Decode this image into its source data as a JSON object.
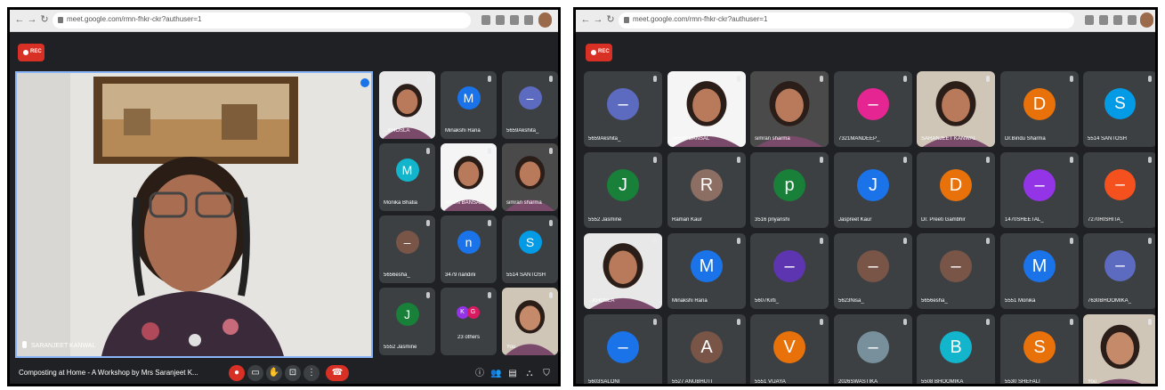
{
  "left": {
    "url": "meet.google.com/rmn-fhkr-ckr?authuser=1",
    "rec_label": "REC",
    "main_speaker": "SARANJEET KANWAL",
    "meeting_title": "Composting at Home - A Workshop by Mrs Saranjeet K...",
    "tiles": [
      {
        "name": "...KHOSLA",
        "type": "photo"
      },
      {
        "name": "Minakshi Rana",
        "type": "avatar",
        "letter": "M",
        "color": "#1a73e8"
      },
      {
        "name": "5659Akshita_",
        "type": "avatar",
        "letter": "–",
        "color": "#5c6bc0"
      },
      {
        "name": "Monika Bhatia",
        "type": "avatar",
        "letter": "M",
        "color": "#12b5cb"
      },
      {
        "name": "ARUN BANSAL",
        "type": "photo"
      },
      {
        "name": "simran sharma",
        "type": "photo"
      },
      {
        "name": "5656esha_",
        "type": "avatar",
        "letter": "–",
        "color": "#795548"
      },
      {
        "name": "3479 nandini",
        "type": "avatar",
        "letter": "n",
        "color": "#1a73e8"
      },
      {
        "name": "5514 SANTOSH",
        "type": "avatar",
        "letter": "S",
        "color": "#039be5"
      },
      {
        "name": "5552 Jasmine",
        "type": "avatar",
        "letter": "J",
        "color": "#188038"
      },
      {
        "name": "23 others",
        "type": "others"
      },
      {
        "name": "You",
        "type": "photo"
      }
    ],
    "others_badges": [
      "K",
      "G"
    ]
  },
  "right": {
    "url": "meet.google.com/rmn-fhkr-ckr?authuser=1",
    "rec_label": "REC",
    "tiles": [
      {
        "name": "5659Akshita_",
        "type": "avatar",
        "letter": "–",
        "color": "#5c6bc0"
      },
      {
        "name": "ARUN BANSAL",
        "type": "photo"
      },
      {
        "name": "simran sharma",
        "type": "photo"
      },
      {
        "name": "7321MANDEEP_",
        "type": "avatar",
        "letter": "–",
        "color": "#e52592"
      },
      {
        "name": "SARANJEET KANWAL",
        "type": "photo"
      },
      {
        "name": "Dr.Bindu Sharma",
        "type": "avatar",
        "letter": "D",
        "color": "#e8710a"
      },
      {
        "name": "5514 SANTOSH",
        "type": "avatar",
        "letter": "S",
        "color": "#039be5"
      },
      {
        "name": "5552 Jasmine",
        "type": "avatar",
        "letter": "J",
        "color": "#188038"
      },
      {
        "name": "Raman Kaur",
        "type": "avatar",
        "letter": "R",
        "color": "#8d6e63"
      },
      {
        "name": "3516 priyanshi",
        "type": "avatar",
        "letter": "p",
        "color": "#188038"
      },
      {
        "name": "Jaspreet Kaur",
        "type": "avatar",
        "letter": "J",
        "color": "#1a73e8"
      },
      {
        "name": "Dr. Preeti Gambhir",
        "type": "avatar",
        "letter": "D",
        "color": "#e8710a"
      },
      {
        "name": "1470SHEETAL_",
        "type": "avatar",
        "letter": "–",
        "color": "#9334e6"
      },
      {
        "name": "7270RISHITA_",
        "type": "avatar",
        "letter": "–",
        "color": "#f4511e"
      },
      {
        "name": "...KHOSLA",
        "type": "photo"
      },
      {
        "name": "Minakshi Rana",
        "type": "avatar",
        "letter": "M",
        "color": "#1a73e8"
      },
      {
        "name": "5607Kirti_",
        "type": "avatar",
        "letter": "–",
        "color": "#5e35b1"
      },
      {
        "name": "5623Nisa_",
        "type": "avatar",
        "letter": "–",
        "color": "#795548"
      },
      {
        "name": "5656esha_",
        "type": "avatar",
        "letter": "–",
        "color": "#795548"
      },
      {
        "name": "5551 Monika",
        "type": "avatar",
        "letter": "M",
        "color": "#1a73e8"
      },
      {
        "name": "7630BHOOMIKA_",
        "type": "avatar",
        "letter": "–",
        "color": "#5c6bc0"
      },
      {
        "name": "5603SALONI_",
        "type": "avatar",
        "letter": "–",
        "color": "#1a73e8"
      },
      {
        "name": "5527 ANUBHUTI",
        "type": "avatar",
        "letter": "A",
        "color": "#795548"
      },
      {
        "name": "5551 VIJAYA",
        "type": "avatar",
        "letter": "V",
        "color": "#e8710a"
      },
      {
        "name": "2026SWASTIKA_",
        "type": "avatar",
        "letter": "–",
        "color": "#78909c"
      },
      {
        "name": "5508 BHOOMIKA",
        "type": "avatar",
        "letter": "B",
        "color": "#12b5cb"
      },
      {
        "name": "5530 SHEFALI",
        "type": "avatar",
        "letter": "S",
        "color": "#e8710a"
      },
      {
        "name": "You",
        "type": "photo"
      }
    ]
  }
}
